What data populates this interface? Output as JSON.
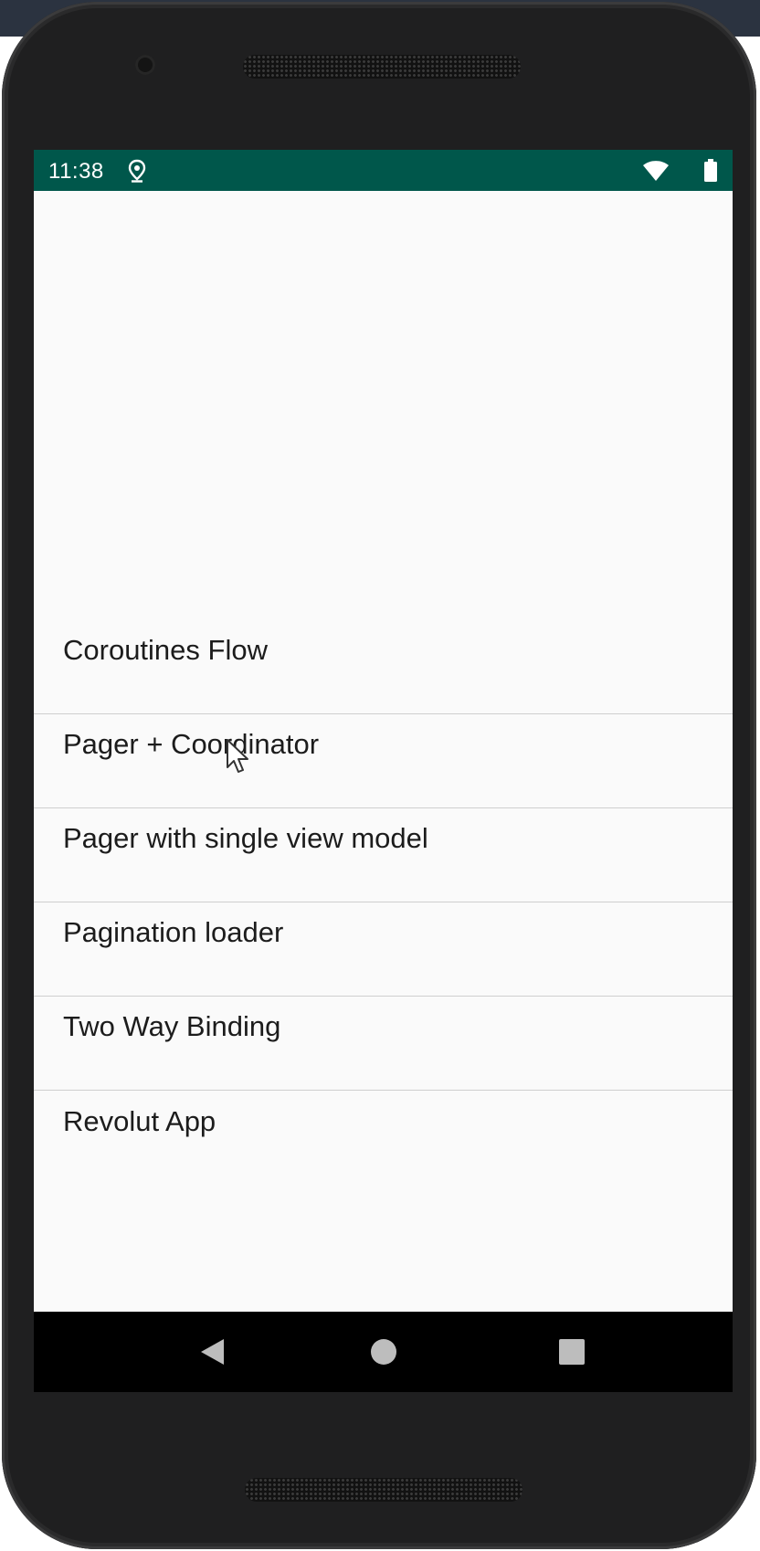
{
  "status_bar": {
    "time": "11:38",
    "background_color": "#00574b",
    "icons": [
      "location-pin-icon",
      "wifi-icon",
      "battery-icon"
    ]
  },
  "menu": {
    "items": [
      {
        "label": "Coroutines Flow"
      },
      {
        "label": "Pager + Coordinator"
      },
      {
        "label": "Pager with single view model"
      },
      {
        "label": "Pagination loader"
      },
      {
        "label": "Two Way Binding"
      },
      {
        "label": "Revolut App"
      }
    ]
  },
  "nav_bar": {
    "buttons": [
      "back-triangle-icon",
      "home-circle-icon",
      "recents-square-icon"
    ]
  },
  "colors": {
    "screen_background": "#fafafa",
    "divider": "#cfcfcf",
    "device_frame": "#1f1f20"
  }
}
